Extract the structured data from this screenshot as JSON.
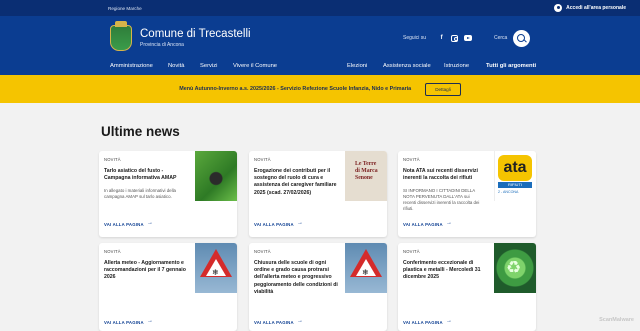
{
  "topbar": {
    "region": "Regione Marche",
    "login": "Accedi all'area personale"
  },
  "header": {
    "title": "Comune di Trecastelli",
    "subtitle": "Provincia di Ancona",
    "social_label": "Seguici su",
    "search_label": "Cerca"
  },
  "nav": {
    "left": [
      "Amministrazione",
      "Novità",
      "Servizi",
      "Vivere il Comune"
    ],
    "right": [
      "Elezioni",
      "Assistenza sociale",
      "Istruzione",
      "Tutti gli argomenti"
    ]
  },
  "alert": {
    "message": "Menù Autunno-Inverno a.s. 2025/2026 - Servizio Refezione Scuole Infanzia, Nido e Primaria",
    "button": "Dettagli"
  },
  "news": {
    "heading": "Ultime news",
    "cards": [
      {
        "category": "NOVITÀ",
        "title": [
          "Tarlo asiatico del fusto -",
          "Campagna informativa AMAP"
        ],
        "description": [
          "In allegato i materiali informativi della",
          "campagna AMAP sul tarlo asiatico."
        ],
        "link": "VAI ALLA PAGINA",
        "image": "tarlo-insect-image"
      },
      {
        "category": "NOVITÀ",
        "title": [
          "Erogazione dei contributi per il",
          "sostegno del ruolo di cura e",
          "assistenza dei caregiver familiare",
          "2025 (scad. 27/02/2026)"
        ],
        "description": [],
        "link": "VAI ALLA PAGINA",
        "image": "book-cover-image",
        "image_text": [
          "Le Terre",
          "di Marca",
          "Senone"
        ]
      },
      {
        "category": "NOVITÀ",
        "title": [
          "Nota ATA sui recenti disservizi",
          "inerenti la raccolta dei rifiuti"
        ],
        "description": [
          "SI INFORMANO I CITTADINI DELLA",
          "NOTA PERVENUTA DALL'ATA sui",
          "recenti disservizi inerenti la raccolta dei",
          "rifiuti."
        ],
        "link": "VAI ALLA PAGINA",
        "image": "ata-logo-image",
        "image_text": [
          "ata",
          "RIFIUTI",
          "2 - ANCONA"
        ]
      },
      {
        "category": "NOVITÀ",
        "title": [
          "Allerta meteo - Aggiornamento e",
          "raccomandazioni per il 7 gennaio",
          "2026"
        ],
        "description": [],
        "link": "VAI ALLA PAGINA",
        "image": "snow-warning-sign-image"
      },
      {
        "category": "NOVITÀ",
        "title": [
          "Chiusura delle scuole di ogni",
          "ordine e grado causa protrarsi",
          "dell'allerta meteo e progressivo",
          "peggioramento delle condizioni di",
          "viabilità"
        ],
        "description": [],
        "link": "VAI ALLA PAGINA",
        "image": "snow-warning-sign-image"
      },
      {
        "category": "NOVITÀ",
        "title": [
          "Conferimento eccezionale di",
          "plastica e metalli - Mercoledì 31",
          "dicembre 2025"
        ],
        "description": [],
        "link": "VAI ALLA PAGINA",
        "image": "recycling-bin-image"
      }
    ]
  },
  "watermark": "ScanMalware"
}
